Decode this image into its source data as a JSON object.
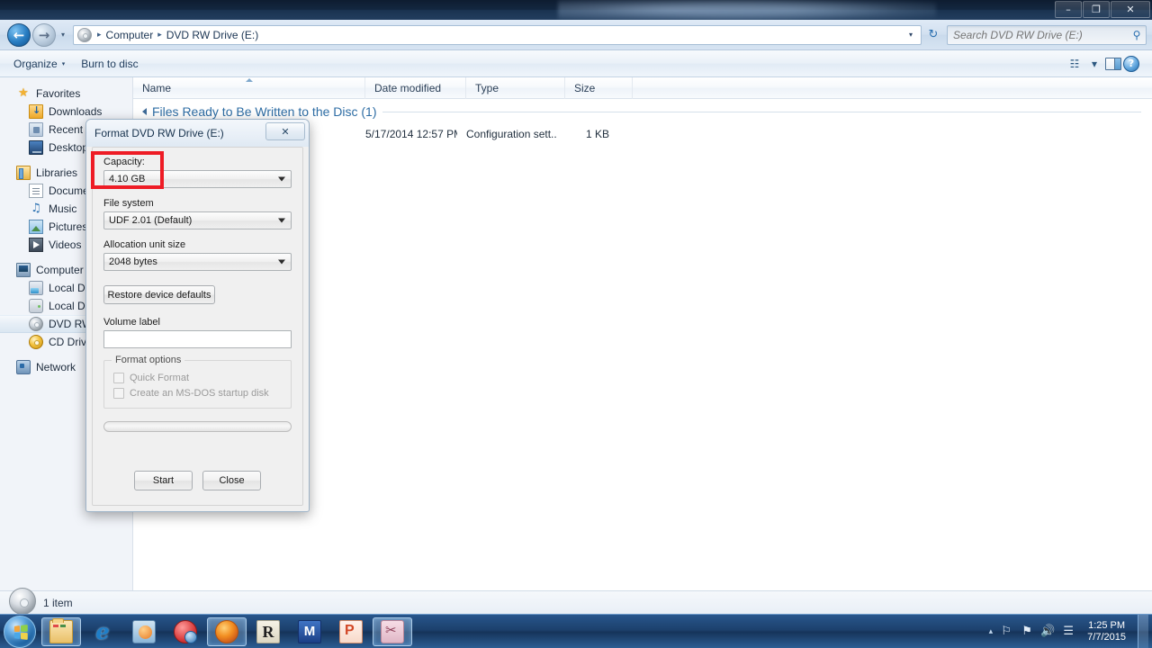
{
  "window": {
    "title_controls": {
      "minimize": "–",
      "restore": "❐",
      "close": "✕"
    }
  },
  "address_bar": {
    "back_icon": "←",
    "forward_icon": "→",
    "history_caret": "▾",
    "breadcrumb": [
      "Computer",
      "DVD RW Drive (E:)"
    ],
    "breadcrumb_separator": "▸",
    "breadcrumb_dropdown": "▾",
    "refresh_icon": "↻",
    "search_placeholder": "Search DVD RW Drive (E:)",
    "search_value": "",
    "search_icon": "⚲"
  },
  "command_bar": {
    "organize_label": "Organize",
    "organize_caret": "▾",
    "burn_label": "Burn to disc",
    "view_icon": "☷",
    "view_caret": "▾"
  },
  "nav_pane": {
    "groups": [
      {
        "root": {
          "label": "Favorites",
          "icon": "star-icon"
        },
        "children": [
          {
            "label": "Downloads",
            "icon": "downloads-folder-icon"
          },
          {
            "label": "Recent Pl",
            "icon": "recent-places-icon"
          },
          {
            "label": "Desktop",
            "icon": "desktop-icon"
          }
        ]
      },
      {
        "root": {
          "label": "Libraries",
          "icon": "libraries-icon"
        },
        "children": [
          {
            "label": "Documen",
            "icon": "documents-icon"
          },
          {
            "label": "Music",
            "icon": "music-icon"
          },
          {
            "label": "Pictures",
            "icon": "pictures-icon"
          },
          {
            "label": "Videos",
            "icon": "videos-icon"
          }
        ]
      },
      {
        "root": {
          "label": "Computer",
          "icon": "computer-icon"
        },
        "children": [
          {
            "label": "Local Disk",
            "icon": "local-disk-system-icon"
          },
          {
            "label": "Local Disk",
            "icon": "local-disk-icon"
          },
          {
            "label": "DVD RW ",
            "icon": "dvd-drive-icon",
            "selected": true
          },
          {
            "label": "CD Drive",
            "icon": "cd-drive-icon"
          }
        ]
      },
      {
        "root": {
          "label": "Network",
          "icon": "network-icon"
        },
        "children": []
      }
    ]
  },
  "file_list": {
    "columns": [
      {
        "label": "Name",
        "sorted": true
      },
      {
        "label": "Date modified"
      },
      {
        "label": "Type"
      },
      {
        "label": "Size"
      }
    ],
    "group": {
      "label": "Files Ready to Be Written to the Disc (1)",
      "collapse_icon": "▸"
    },
    "rows": [
      {
        "name": "",
        "date_modified": "5/17/2014 12:57 PM",
        "type": "Configuration sett...",
        "size": "1 KB"
      }
    ]
  },
  "status_bar": {
    "item_count": "1 item",
    "icon": "disc-icon"
  },
  "format_dialog": {
    "title": "Format DVD RW Drive (E:)",
    "close_label": "✕",
    "capacity": {
      "label": "Capacity:",
      "value": "4.10 GB",
      "arrow": "▾"
    },
    "file_system": {
      "label": "File system",
      "value": "UDF 2.01 (Default)",
      "arrow": "▾"
    },
    "allocation_unit": {
      "label": "Allocation unit size",
      "value": "2048 bytes",
      "arrow": "▾"
    },
    "restore_defaults_label": "Restore device defaults",
    "volume_label": {
      "label": "Volume label",
      "value": "",
      "placeholder": ""
    },
    "format_options": {
      "legend": "Format options",
      "items": [
        {
          "label": "Quick Format",
          "checked": false,
          "disabled": true
        },
        {
          "label": "Create an MS-DOS startup disk",
          "checked": false,
          "disabled": true
        }
      ]
    },
    "progress_percent": 0,
    "buttons": {
      "start": "Start",
      "close": "Close"
    },
    "highlight_color": "#ee1c25"
  },
  "taskbar": {
    "start_label": "Start",
    "items": [
      {
        "name": "windows-explorer",
        "icon": "explorer-icon",
        "active": true
      },
      {
        "name": "internet-explorer",
        "icon": "ie-icon",
        "glyph": "e"
      },
      {
        "name": "windows-media-player",
        "icon": "wmp-icon"
      },
      {
        "name": "itunes",
        "icon": "itunes-icon"
      },
      {
        "name": "firefox",
        "icon": "firefox-icon",
        "active": true
      },
      {
        "name": "r-console",
        "icon": "r-icon",
        "glyph": "R"
      },
      {
        "name": "mendeley",
        "icon": "m-icon",
        "glyph": "M"
      },
      {
        "name": "powerpoint",
        "icon": "ppt-icon"
      },
      {
        "name": "snipping-tool",
        "icon": "snip-icon"
      }
    ],
    "tray": {
      "expand_caret": "▴",
      "icons": [
        "network-flag-icon",
        "action-center-icon",
        "volume-icon",
        "signal-icon"
      ],
      "volume_glyph": "◂))",
      "time": "1:25 PM",
      "date": "7/7/2015"
    }
  }
}
